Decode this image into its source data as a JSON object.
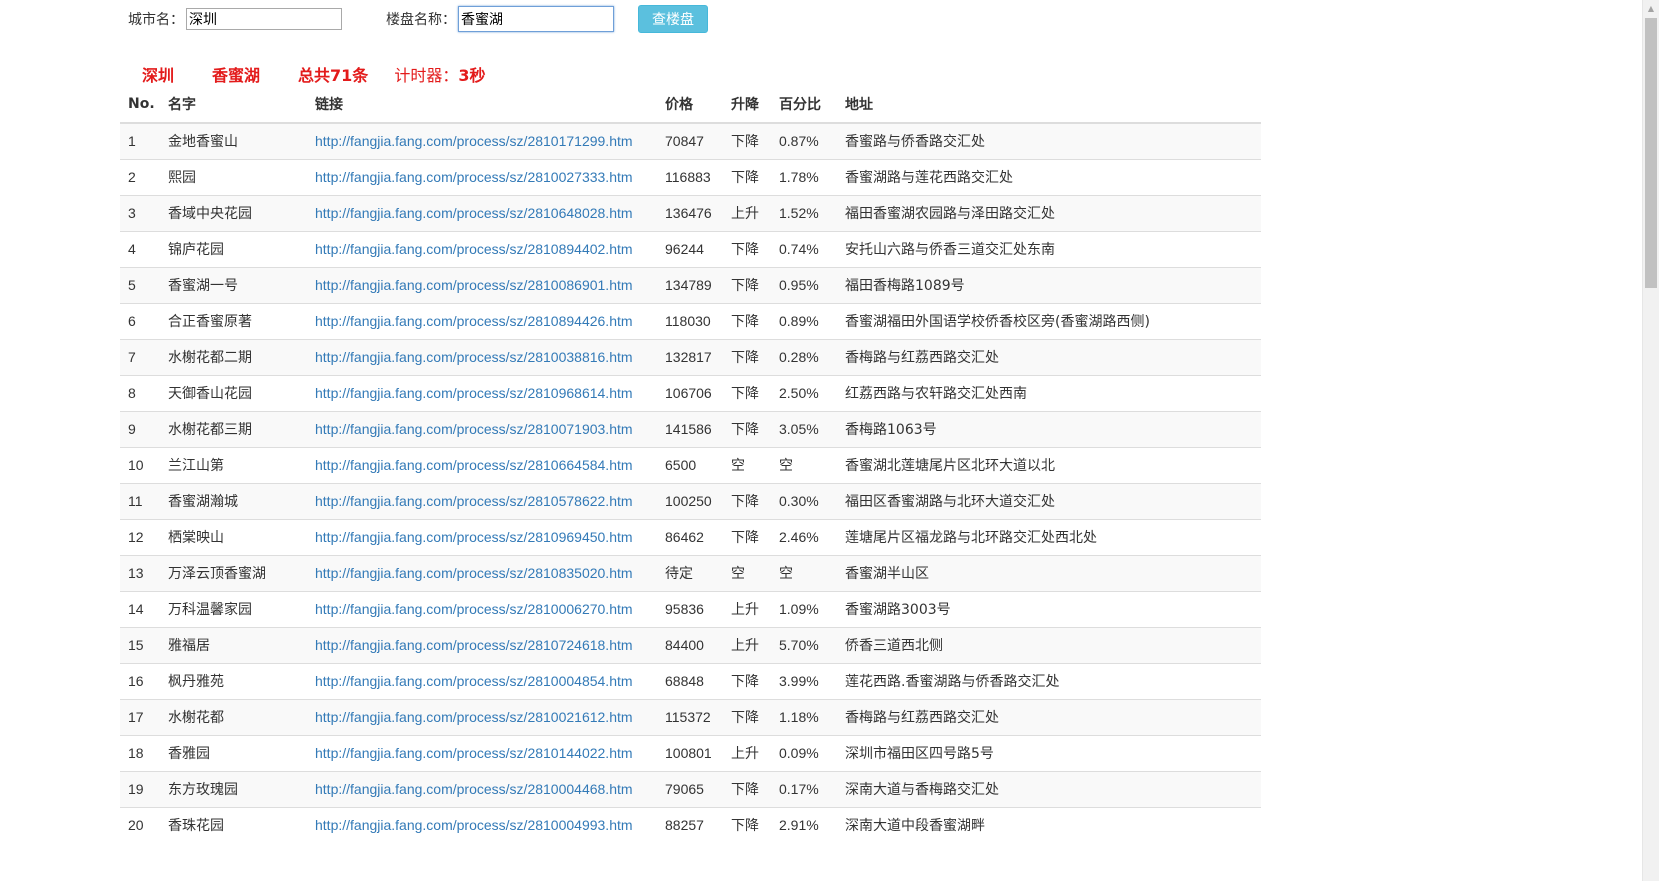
{
  "search": {
    "city_label": "城市名：",
    "city_value": "深圳",
    "estate_label": "楼盘名称：",
    "estate_value": "香蜜湖",
    "button_label": "查楼盘"
  },
  "summary": {
    "city": "深圳",
    "estate": "香蜜湖",
    "total": "总共71条",
    "timer_label": "计时器：",
    "timer_value": "3秒"
  },
  "table": {
    "headers": [
      "No.",
      "名字",
      "链接",
      "价格",
      "升降",
      "百分比",
      "地址"
    ],
    "rows": [
      {
        "no": "1",
        "name": "金地香蜜山",
        "link": "http://fangjia.fang.com/process/sz/2810171299.htm",
        "price": "70847",
        "trend": "下降",
        "percent": "0.87%",
        "address": "香蜜路与侨香路交汇处"
      },
      {
        "no": "2",
        "name": "熙园",
        "link": "http://fangjia.fang.com/process/sz/2810027333.htm",
        "price": "116883",
        "trend": "下降",
        "percent": "1.78%",
        "address": "香蜜湖路与莲花西路交汇处"
      },
      {
        "no": "3",
        "name": "香域中央花园",
        "link": "http://fangjia.fang.com/process/sz/2810648028.htm",
        "price": "136476",
        "trend": "上升",
        "percent": "1.52%",
        "address": "福田香蜜湖农园路与泽田路交汇处"
      },
      {
        "no": "4",
        "name": "锦庐花园",
        "link": "http://fangjia.fang.com/process/sz/2810894402.htm",
        "price": "96244",
        "trend": "下降",
        "percent": "0.74%",
        "address": "安托山六路与侨香三道交汇处东南"
      },
      {
        "no": "5",
        "name": "香蜜湖一号",
        "link": "http://fangjia.fang.com/process/sz/2810086901.htm",
        "price": "134789",
        "trend": "下降",
        "percent": "0.95%",
        "address": "福田香梅路1089号"
      },
      {
        "no": "6",
        "name": "合正香蜜原著",
        "link": "http://fangjia.fang.com/process/sz/2810894426.htm",
        "price": "118030",
        "trend": "下降",
        "percent": "0.89%",
        "address": "香蜜湖福田外国语学校侨香校区旁(香蜜湖路西侧)"
      },
      {
        "no": "7",
        "name": "水榭花都二期",
        "link": "http://fangjia.fang.com/process/sz/2810038816.htm",
        "price": "132817",
        "trend": "下降",
        "percent": "0.28%",
        "address": "香梅路与红荔西路交汇处"
      },
      {
        "no": "8",
        "name": "天御香山花园",
        "link": "http://fangjia.fang.com/process/sz/2810968614.htm",
        "price": "106706",
        "trend": "下降",
        "percent": "2.50%",
        "address": "红荔西路与农轩路交汇处西南"
      },
      {
        "no": "9",
        "name": "水榭花都三期",
        "link": "http://fangjia.fang.com/process/sz/2810071903.htm",
        "price": "141586",
        "trend": "下降",
        "percent": "3.05%",
        "address": "香梅路1063号"
      },
      {
        "no": "10",
        "name": "兰江山第",
        "link": "http://fangjia.fang.com/process/sz/2810664584.htm",
        "price": "6500",
        "trend": "空",
        "percent": "空",
        "address": "香蜜湖北莲塘尾片区北环大道以北"
      },
      {
        "no": "11",
        "name": "香蜜湖瀚城",
        "link": "http://fangjia.fang.com/process/sz/2810578622.htm",
        "price": "100250",
        "trend": "下降",
        "percent": "0.30%",
        "address": "福田区香蜜湖路与北环大道交汇处"
      },
      {
        "no": "12",
        "name": "栖棠映山",
        "link": "http://fangjia.fang.com/process/sz/2810969450.htm",
        "price": "86462",
        "trend": "下降",
        "percent": "2.46%",
        "address": "莲塘尾片区福龙路与北环路交汇处西北处"
      },
      {
        "no": "13",
        "name": "万泽云顶香蜜湖",
        "link": "http://fangjia.fang.com/process/sz/2810835020.htm",
        "price": "待定",
        "trend": "空",
        "percent": "空",
        "address": "香蜜湖半山区"
      },
      {
        "no": "14",
        "name": "万科温馨家园",
        "link": "http://fangjia.fang.com/process/sz/2810006270.htm",
        "price": "95836",
        "trend": "上升",
        "percent": "1.09%",
        "address": "香蜜湖路3003号"
      },
      {
        "no": "15",
        "name": "雅福居",
        "link": "http://fangjia.fang.com/process/sz/2810724618.htm",
        "price": "84400",
        "trend": "上升",
        "percent": "5.70%",
        "address": "侨香三道西北侧"
      },
      {
        "no": "16",
        "name": "枫丹雅苑",
        "link": "http://fangjia.fang.com/process/sz/2810004854.htm",
        "price": "68848",
        "trend": "下降",
        "percent": "3.99%",
        "address": "莲花西路.香蜜湖路与侨香路交汇处"
      },
      {
        "no": "17",
        "name": "水榭花都",
        "link": "http://fangjia.fang.com/process/sz/2810021612.htm",
        "price": "115372",
        "trend": "下降",
        "percent": "1.18%",
        "address": "香梅路与红荔西路交汇处"
      },
      {
        "no": "18",
        "name": "香雅园",
        "link": "http://fangjia.fang.com/process/sz/2810144022.htm",
        "price": "100801",
        "trend": "上升",
        "percent": "0.09%",
        "address": "深圳市福田区四号路5号"
      },
      {
        "no": "19",
        "name": "东方玫瑰园",
        "link": "http://fangjia.fang.com/process/sz/2810004468.htm",
        "price": "79065",
        "trend": "下降",
        "percent": "0.17%",
        "address": "深南大道与香梅路交汇处"
      },
      {
        "no": "20",
        "name": "香珠花园",
        "link": "http://fangjia.fang.com/process/sz/2810004993.htm",
        "price": "88257",
        "trend": "下降",
        "percent": "2.91%",
        "address": "深南大道中段香蜜湖畔"
      }
    ]
  },
  "colors": {
    "accent_red": "#e31b1b",
    "link_blue": "#337ab7",
    "button_bg": "#5bc0de"
  }
}
